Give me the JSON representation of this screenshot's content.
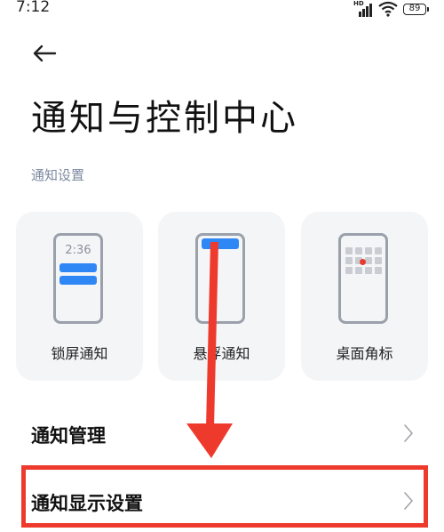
{
  "status_bar": {
    "time": "7:12",
    "network_label": "HD",
    "battery": "89"
  },
  "header": {
    "back_icon": "arrow-left-icon",
    "title": "通知与控制中心"
  },
  "notification_settings": {
    "section_label": "通知设置",
    "cards": [
      {
        "label": "锁屏通知",
        "preview_time": "2:36"
      },
      {
        "label": "悬浮通知"
      },
      {
        "label": "桌面角标"
      }
    ]
  },
  "list": {
    "items": [
      {
        "label": "通知管理",
        "icon": "chevron-right-icon"
      },
      {
        "label": "通知显示设置",
        "icon": "chevron-right-icon"
      }
    ]
  },
  "annotation": {
    "color": "#ee3a2d"
  },
  "colors": {
    "accent": "#2f86f5",
    "badge": "#e63a2e",
    "card_bg": "#f4f5f7"
  }
}
